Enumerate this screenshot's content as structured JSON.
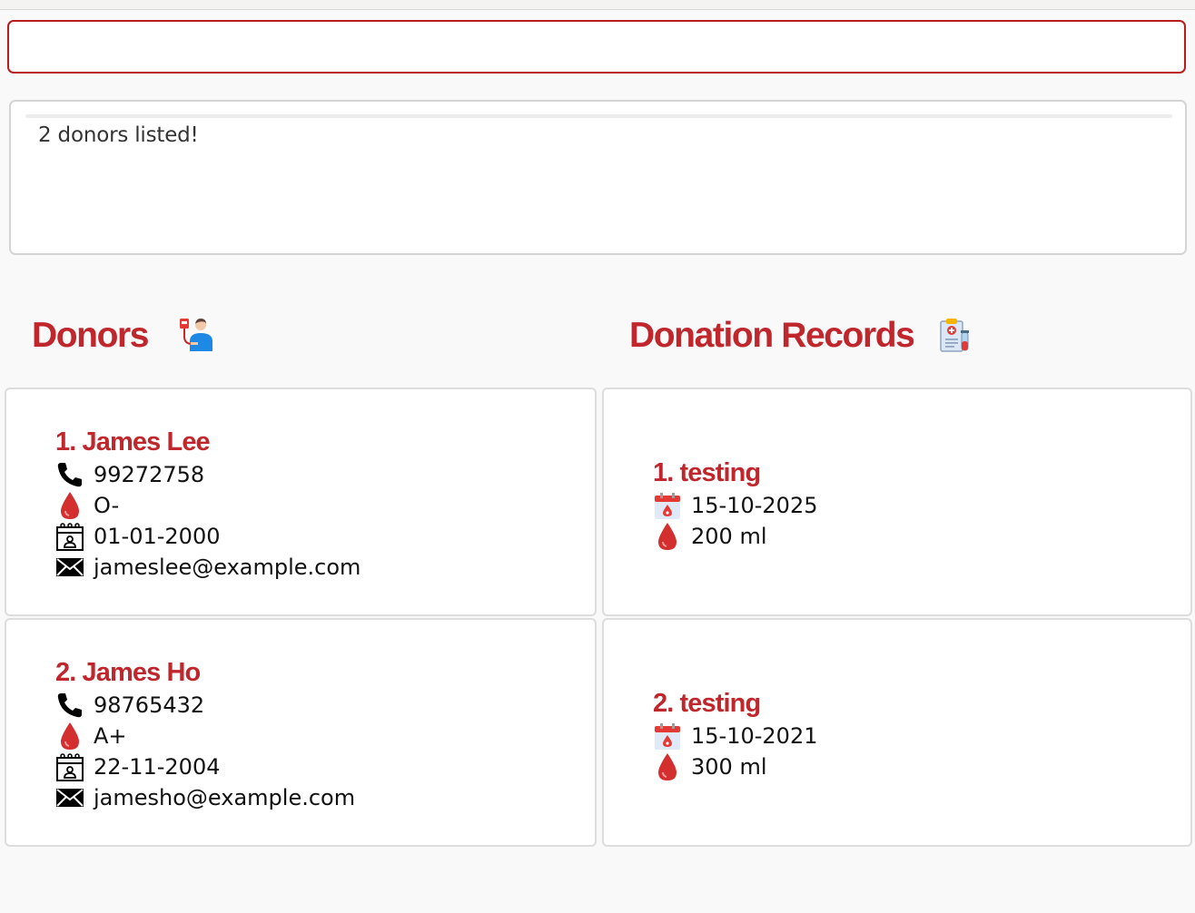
{
  "command_box": {
    "value": "",
    "placeholder": ""
  },
  "result_display": {
    "message": "2 donors listed!"
  },
  "panels": {
    "donors": {
      "title": "Donors",
      "icon": "donor-icon"
    },
    "records": {
      "title": "Donation Records",
      "icon": "medical-record-icon"
    }
  },
  "donors": [
    {
      "name": "1. James Lee",
      "phone": "99272758",
      "blood_type": "O-",
      "dob": "01-01-2000",
      "email": "jameslee@example.com"
    },
    {
      "name": "2. James Ho",
      "phone": "98765432",
      "blood_type": "A+",
      "dob": "22-11-2004",
      "email": "jamesho@example.com"
    }
  ],
  "records": [
    {
      "name": "1. testing",
      "date": "15-10-2025",
      "volume": "200 ml"
    },
    {
      "name": "2. testing",
      "date": "15-10-2021",
      "volume": "300 ml"
    }
  ],
  "colors": {
    "accent": "#c0272d",
    "border": "#dddddd",
    "command_border": "#b91c1c"
  }
}
